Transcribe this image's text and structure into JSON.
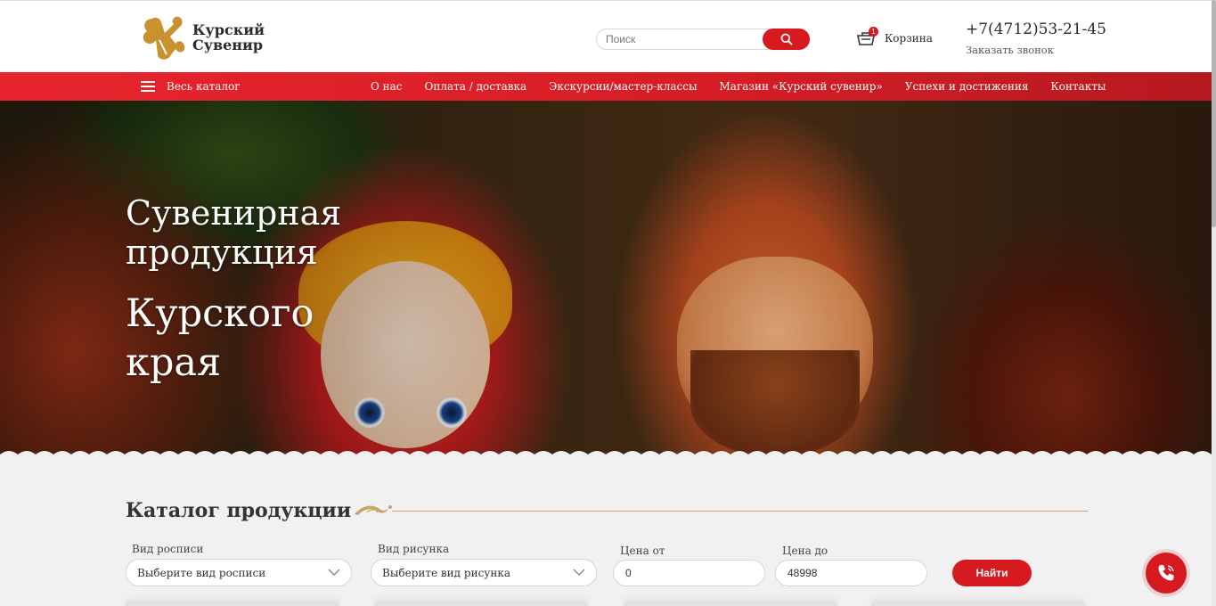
{
  "header": {
    "logo_line1": "Курский",
    "logo_line2": "Сувенир",
    "search_placeholder": "Поиск",
    "cart_label": "Корзина",
    "cart_count": "1",
    "phone": "+7(4712)53-21-45",
    "callback": "Заказать звонок"
  },
  "nav": {
    "catalog": "Весь каталог",
    "links": [
      "О нас",
      "Оплата / доставка",
      "Экскурсии/мастер-классы",
      "Магазин «Курский сувенир»",
      "Успехи и достижения",
      "Контакты"
    ]
  },
  "hero": {
    "title_line1": "Сувенирная",
    "title_line2": "продукция",
    "subtitle_line1": "Курского",
    "subtitle_line2": "края"
  },
  "catalog": {
    "title": "Каталог продукции",
    "painting_label": "Вид росписи",
    "painting_placeholder": "Выберите вид росписи",
    "pattern_label": "Вид рисунка",
    "pattern_placeholder": "Выберите вид рисунка",
    "price_from_label": "Цена от",
    "price_from": "0",
    "price_to_label": "Цена до",
    "price_to": "48998",
    "submit": "Найти"
  },
  "colors": {
    "accent": "#d71920",
    "gold": "#c9a46a"
  },
  "icons": [
    "logo-mark-icon",
    "search-icon",
    "cart-icon",
    "menu-icon",
    "chevron-down-icon",
    "ornament-icon",
    "phone-icon"
  ]
}
